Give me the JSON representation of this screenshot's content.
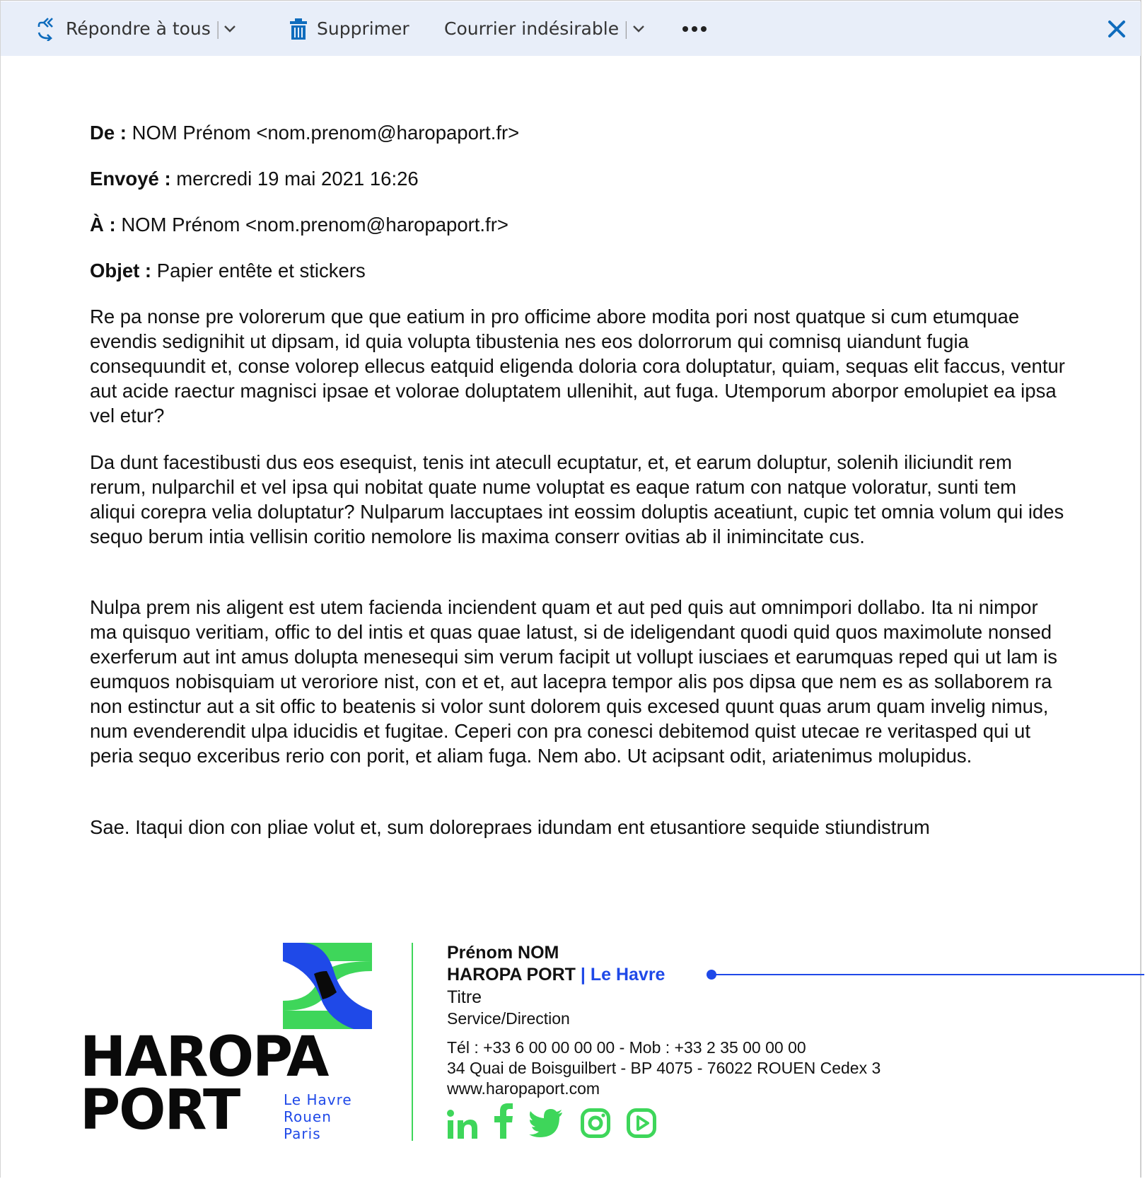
{
  "toolbar": {
    "reply_all_label": "Répondre à tous",
    "delete_label": "Supprimer",
    "junk_label": "Courrier indésirable",
    "more_label": "•••",
    "separator": "|",
    "icons": [
      "reply-all-icon",
      "chevron-down-icon",
      "trash-icon",
      "more-icon",
      "close-icon"
    ],
    "accent_color": "#0f6cbd"
  },
  "email": {
    "from_label": "De :",
    "from_value": "NOM Prénom <nom.prenom@haropaport.fr>",
    "sent_label": "Envoyé :",
    "sent_value": "mercredi 19 mai 2021 16:26",
    "to_label": "À :",
    "to_value": "NOM Prénom <nom.prenom@haropaport.fr>",
    "subject_label": "Objet :",
    "subject_value": "Papier entête et stickers",
    "body": [
      "Re pa nonse pre volorerum que que eatium in pro officime abore modita pori nost quatque si cum etumquae evendis sedignihit ut dipsam, id quia volupta tibustenia nes eos dolorrorum qui comnisq uiandunt fugia consequundit et, conse volorep ellecus eatquid eligenda doloria cora doluptatur, quiam, sequas elit faccus, ventur aut acide raectur magnisci ipsae et volorae doluptatem ullenihit, aut fuga. Utemporum aborpor emolupiet ea ipsa vel etur?",
      "Da dunt facestibusti dus eos esequist, tenis int atecull ecuptatur, et, et earum doluptur, solenih iliciundit rem rerum, nulparchil et vel ipsa qui nobitat quate nume voluptat es eaque ratum con natque voloratur, sunti tem aliqui corepra velia doluptatur? Nulparum laccuptaes int eossim doluptis aceatiunt, cupic tet omnia volum qui ides sequo berum intia vellisin coritio nemolore lis maxima conserr ovitias ab il inimincitate cus.",
      "Nulpa prem nis aligent est utem facienda inciendent quam et aut ped quis aut omnimpori dollabo. Ita ni nimpor ma quisquo veritiam, offic to del intis et quas quae latust, si de ideligendant quodi quid quos maximolute nonsed exerferum aut int amus dolupta menesequi sim verum facipit ut vollupt iusciaes et earumquas reped qui ut lam is eumquos nobisquiam ut veroriore nist, con et et, aut lacepra tempor alis pos dipsa que nem es as sollaborem ra non estinctur aut a sit offic to beatenis si volor sunt dolorem quis excesed quunt quas arum quam invelig nimus, num evenderendit ulpa iducidis et fugitae. Ceperi con pra conesci debitemod quist utecae re veritasped qui ut peria sequo exceribus rerio con porit, et aliam fuga. Nem abo. Ut acipsant odit, ariatenimus molupidus.",
      "Sae. Itaqui dion con pliae volut et, sum dolorepraes idundam ent etusantiore sequide stiundistrum"
    ]
  },
  "signature": {
    "name": "Prénom  NOM",
    "company": "HAROPA PORT",
    "location": "| Le Havre",
    "title": "Titre",
    "service": "Service/Direction",
    "phone": "Tél : +33 6 00 00 00 00 - Mob : +33 2 35 00 00 00",
    "address": "34 Quai de Boisguilbert - BP 4075 - 76022 ROUEN Cedex 3",
    "website": "www.haropaport.com",
    "logo": {
      "line1": "HAROPA",
      "line2": "PORT",
      "cities": [
        "Le Havre",
        "Rouen",
        "Paris"
      ]
    },
    "social_icons": [
      "linkedin-icon",
      "facebook-icon",
      "twitter-icon",
      "instagram-icon",
      "youtube-icon"
    ],
    "colors": {
      "green": "#3ed65a",
      "blue": "#1f49e8",
      "black": "#0a0a0a"
    }
  }
}
